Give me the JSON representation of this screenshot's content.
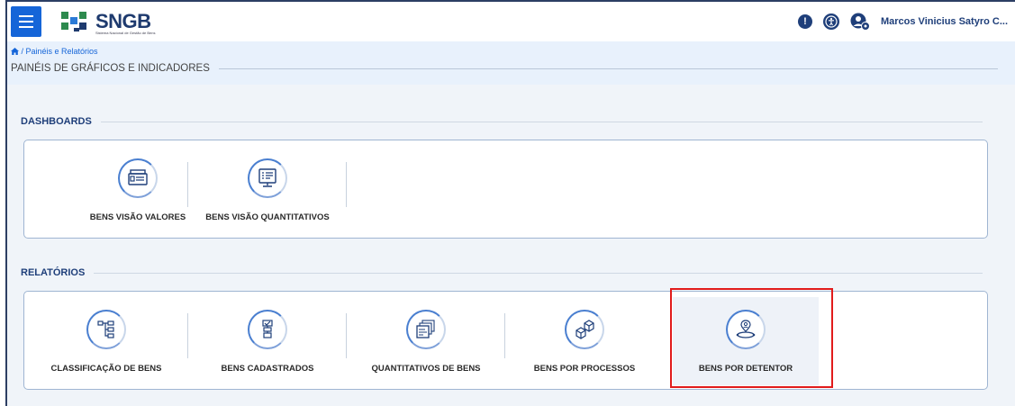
{
  "header": {
    "logo_text": "SNGB",
    "logo_subtitle": "Sistema Nacional de Gestão de Bens",
    "info_icon": "info-icon",
    "accessibility_icon": "accessibility-icon",
    "user_icon": "user-settings-icon",
    "user_name": "Marcos Vinicius Satyro C..."
  },
  "breadcrumb": {
    "home_icon": "home-icon",
    "text": "/ Painéis e Relatórios"
  },
  "page_title": "PAINÉIS DE GRÁFICOS E INDICADORES",
  "dashboards": {
    "title": "DASHBOARDS",
    "items": [
      {
        "label": "BENS VISÃO VALORES",
        "icon": "money-stack-icon"
      },
      {
        "label": "BENS VISÃO QUANTITATIVOS",
        "icon": "monitor-list-icon"
      }
    ]
  },
  "relatorios": {
    "title": "RELATÓRIOS",
    "items": [
      {
        "label": "CLASSIFICAÇÃO DE BENS",
        "icon": "hierarchy-icon"
      },
      {
        "label": "BENS CADASTRADOS",
        "icon": "checklist-flow-icon"
      },
      {
        "label": "QUANTITATIVOS DE BENS",
        "icon": "stacked-windows-icon"
      },
      {
        "label": "BENS POR PROCESSOS",
        "icon": "boxes-icon"
      },
      {
        "label": "BENS POR DETENTOR",
        "icon": "person-location-icon"
      }
    ]
  },
  "colors": {
    "accent": "#1565d8",
    "brand_dark": "#1f3f7a",
    "highlight": "#e11b1b"
  }
}
